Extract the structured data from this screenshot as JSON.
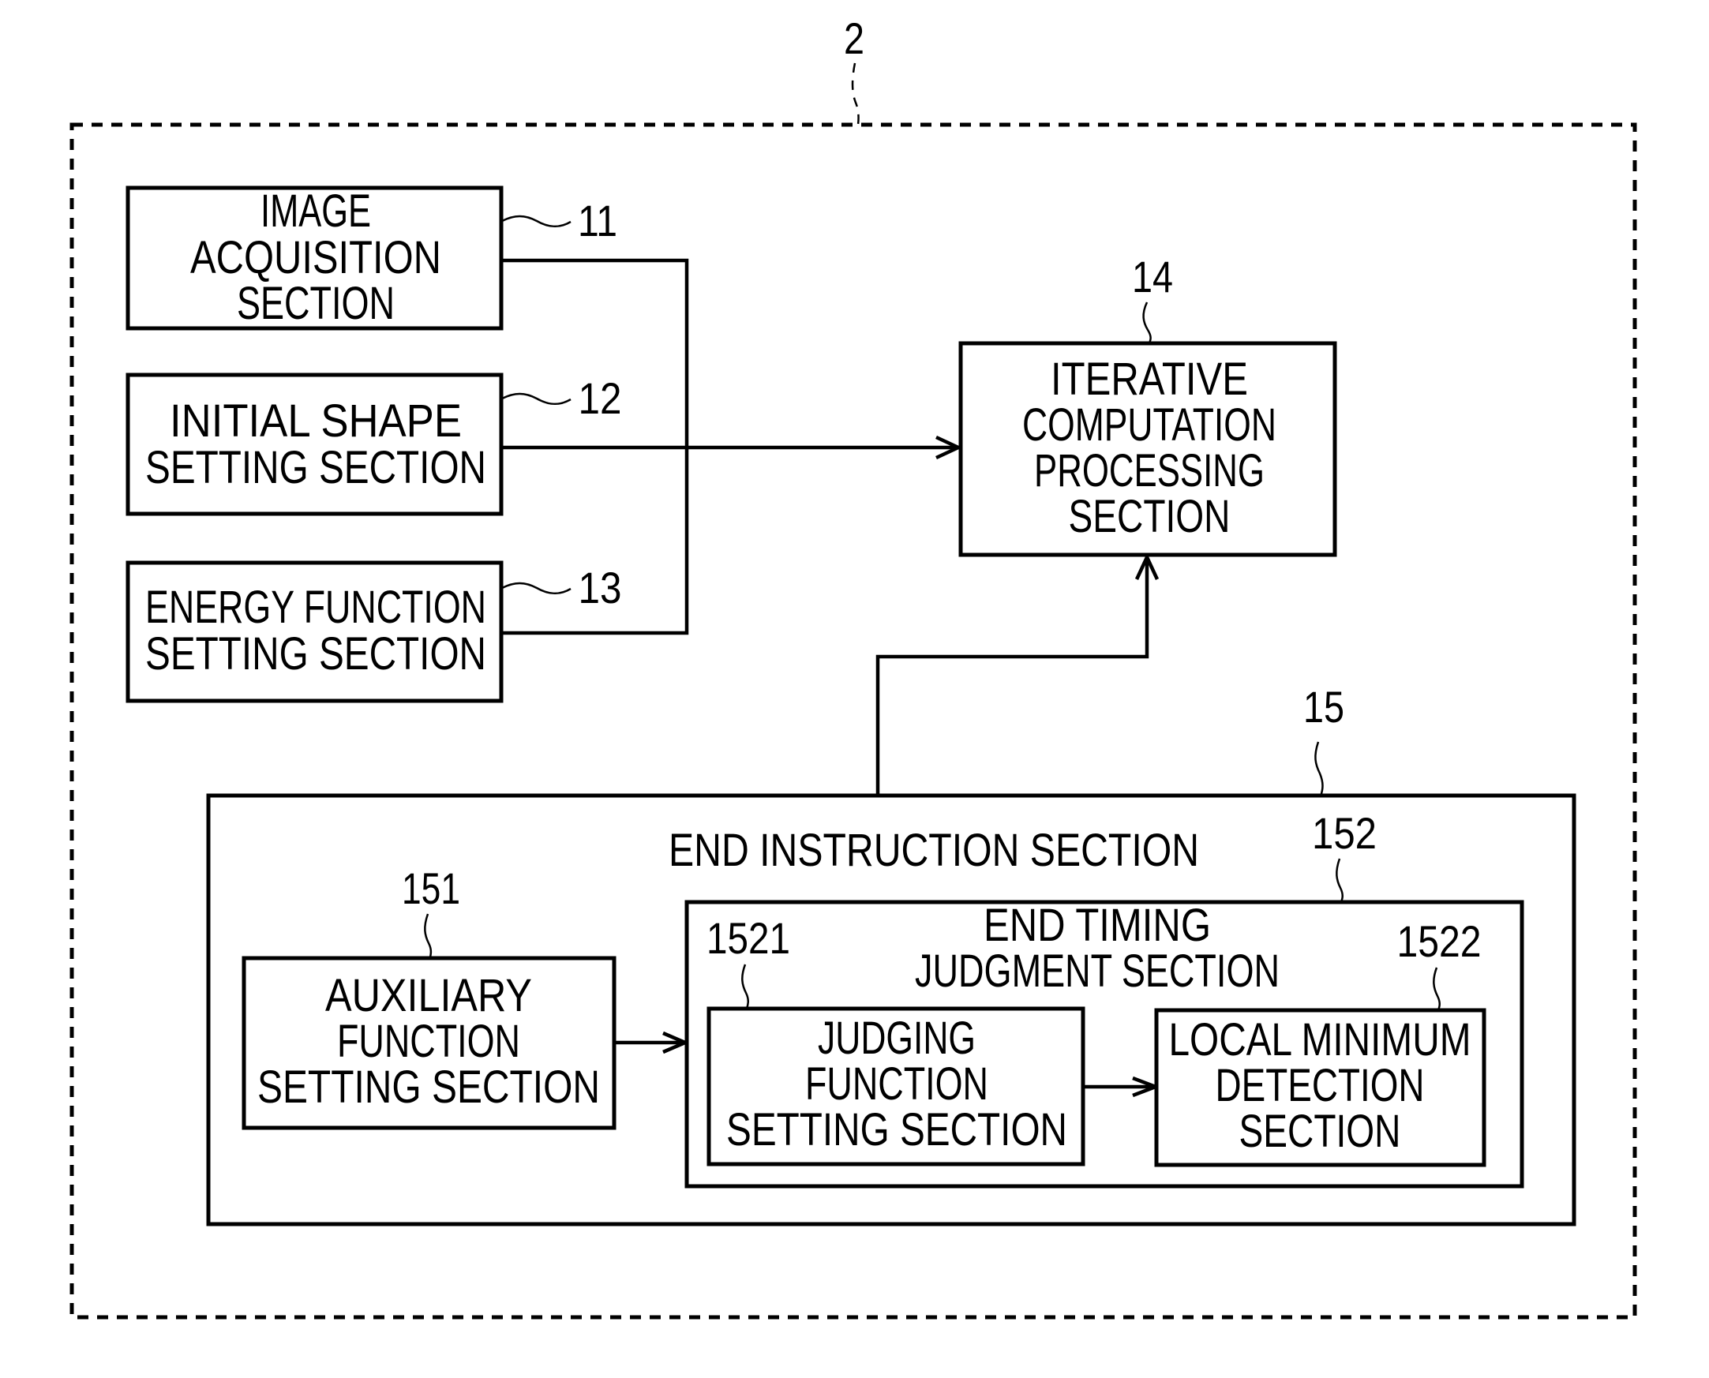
{
  "figure": {
    "system_ref": "2",
    "blocks": {
      "image_acquisition": {
        "ref": "11",
        "lines": [
          "IMAGE",
          "ACQUISITION",
          "SECTION"
        ]
      },
      "initial_shape": {
        "ref": "12",
        "lines": [
          "INITIAL SHAPE",
          "SETTING SECTION"
        ]
      },
      "energy_function": {
        "ref": "13",
        "lines": [
          "ENERGY FUNCTION",
          "SETTING SECTION"
        ]
      },
      "iterative_computation": {
        "ref": "14",
        "lines": [
          "ITERATIVE",
          "COMPUTATION",
          "PROCESSING",
          "SECTION"
        ]
      },
      "end_instruction": {
        "ref": "15",
        "lines": [
          "END INSTRUCTION SECTION"
        ]
      },
      "auxiliary_function": {
        "ref": "151",
        "lines": [
          "AUXILIARY",
          "FUNCTION",
          "SETTING SECTION"
        ]
      },
      "end_timing_judgment": {
        "ref": "152",
        "lines": [
          "END TIMING",
          "JUDGMENT SECTION"
        ]
      },
      "judging_function": {
        "ref": "1521",
        "lines": [
          "JUDGING",
          "FUNCTION",
          "SETTING SECTION"
        ]
      },
      "local_minimum": {
        "ref": "1522",
        "lines": [
          "LOCAL MINIMUM",
          "DETECTION",
          "SECTION"
        ]
      }
    },
    "connections": [
      {
        "from": "image_acquisition",
        "to": "iterative_computation"
      },
      {
        "from": "initial_shape",
        "to": "iterative_computation"
      },
      {
        "from": "energy_function",
        "to": "iterative_computation"
      },
      {
        "from": "end_instruction",
        "to": "iterative_computation"
      },
      {
        "from": "auxiliary_function",
        "to": "end_timing_judgment"
      },
      {
        "from": "judging_function",
        "to": "local_minimum"
      }
    ]
  }
}
